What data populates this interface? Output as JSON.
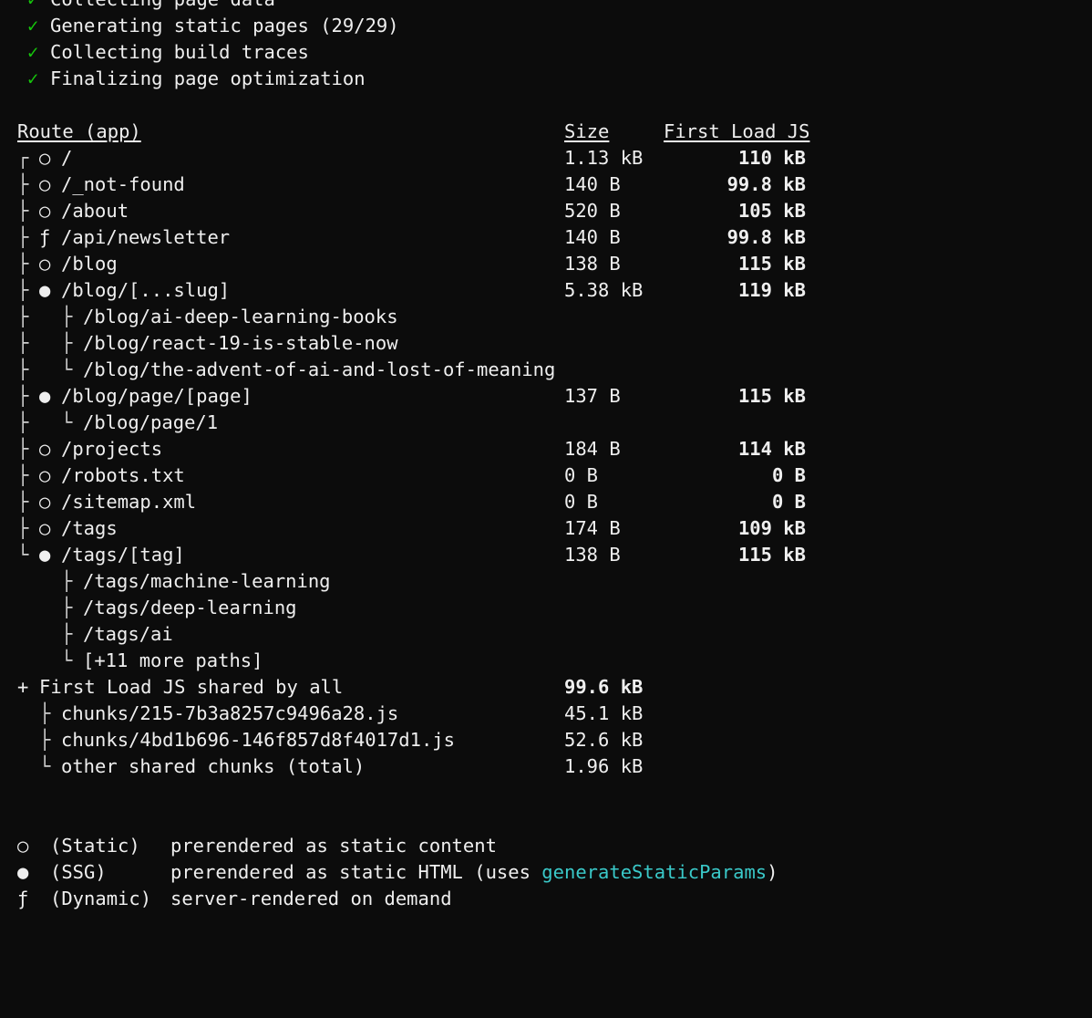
{
  "progress": [
    {
      "mark": "✓",
      "text": "Collecting page data"
    },
    {
      "mark": "✓",
      "text": "Generating static pages (29/29)"
    },
    {
      "mark": "✓",
      "text": "Collecting build traces"
    },
    {
      "mark": "✓",
      "text": "Finalizing page optimization"
    }
  ],
  "table": {
    "headers": {
      "route": "Route (app)",
      "size": "Size",
      "first_load": "First Load JS"
    },
    "rows": [
      {
        "tree": "┌",
        "sym": "○",
        "route": "/",
        "size": "1.13 kB",
        "first": "110 kB"
      },
      {
        "tree": "├",
        "sym": "○",
        "route": "/_not-found",
        "size": "140 B",
        "first": "99.8 kB"
      },
      {
        "tree": "├",
        "sym": "○",
        "route": "/about",
        "size": "520 B",
        "first": "105 kB"
      },
      {
        "tree": "├",
        "sym": "ƒ",
        "route": "/api/newsletter",
        "size": "140 B",
        "first": "99.8 kB"
      },
      {
        "tree": "├",
        "sym": "○",
        "route": "/blog",
        "size": "138 B",
        "first": "115 kB"
      },
      {
        "tree": "├",
        "sym": "●",
        "route": "/blog/[...slug]",
        "size": "5.38 kB",
        "first": "119 kB"
      },
      {
        "tree": "├",
        "sub": "├",
        "route": "/blog/ai-deep-learning-books"
      },
      {
        "tree": "├",
        "sub": "├",
        "route": "/blog/react-19-is-stable-now"
      },
      {
        "tree": "├",
        "sub": "└",
        "route": "/blog/the-advent-of-ai-and-lost-of-meaning"
      },
      {
        "tree": "├",
        "sym": "●",
        "route": "/blog/page/[page]",
        "size": "137 B",
        "first": "115 kB"
      },
      {
        "tree": "├",
        "sub": "└",
        "route": "/blog/page/1"
      },
      {
        "tree": "├",
        "sym": "○",
        "route": "/projects",
        "size": "184 B",
        "first": "114 kB"
      },
      {
        "tree": "├",
        "sym": "○",
        "route": "/robots.txt",
        "size": "0 B",
        "first": "0 B"
      },
      {
        "tree": "├",
        "sym": "○",
        "route": "/sitemap.xml",
        "size": "0 B",
        "first": "0 B"
      },
      {
        "tree": "├",
        "sym": "○",
        "route": "/tags",
        "size": "174 B",
        "first": "109 kB"
      },
      {
        "tree": "└",
        "sym": "●",
        "route": "/tags/[tag]",
        "size": "138 B",
        "first": "115 kB"
      },
      {
        "tree": "",
        "sub": "├",
        "route": "/tags/machine-learning"
      },
      {
        "tree": "",
        "sub": "├",
        "route": "/tags/deep-learning"
      },
      {
        "tree": "",
        "sub": "├",
        "route": "/tags/ai"
      },
      {
        "tree": "",
        "sub": "└",
        "route": "[+11 more paths]"
      }
    ]
  },
  "shared": {
    "prefix": "+",
    "title": "First Load JS shared by all",
    "total": "99.6 kB",
    "chunks": [
      {
        "tree": "├",
        "name": "chunks/215-7b3a8257c9496a28.js",
        "size": "45.1 kB"
      },
      {
        "tree": "├",
        "name": "chunks/4bd1b696-146f857d8f4017d1.js",
        "size": "52.6 kB"
      },
      {
        "tree": "└",
        "name": "other shared chunks (total)",
        "size": "1.96 kB"
      }
    ]
  },
  "legend": [
    {
      "sym": "○",
      "label": "(Static)",
      "desc": "prerendered as static content"
    },
    {
      "sym": "●",
      "label": "(SSG)",
      "desc": "prerendered as static HTML (uses ",
      "highlight": "generateStaticParams",
      "desc_end": ")"
    },
    {
      "sym": "ƒ",
      "label": "(Dynamic)",
      "desc": "server-rendered on demand"
    }
  ],
  "colors": {
    "background": "#0c0c0c",
    "text": "#efefef",
    "check": "#16c60c",
    "highlight": "#3ac9c9"
  }
}
